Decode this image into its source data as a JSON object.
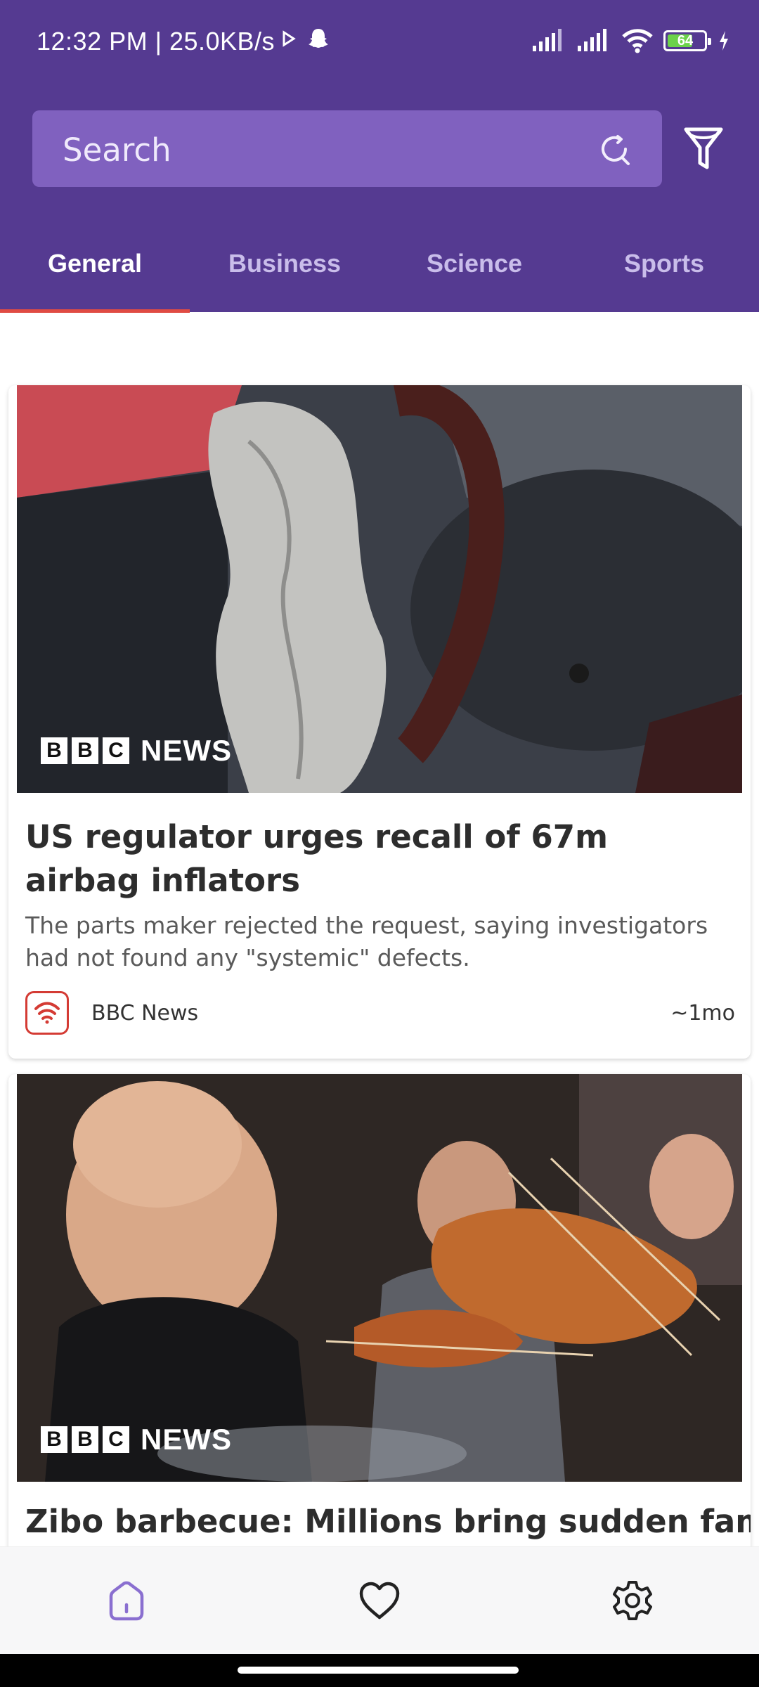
{
  "status_bar": {
    "time_speed": "12:32 PM | 25.0KB/s",
    "battery_level": "64"
  },
  "search": {
    "placeholder": "Search"
  },
  "tabs": [
    {
      "label": "General",
      "active": true
    },
    {
      "label": "Business",
      "active": false
    },
    {
      "label": "Science",
      "active": false
    },
    {
      "label": "Sports",
      "active": false
    }
  ],
  "articles": [
    {
      "image_logo": {
        "letters": [
          "B",
          "B",
          "C"
        ],
        "word": "NEWS"
      },
      "title": "US regulator urges recall of 67m airbag inflators",
      "description": "The parts maker rejected the request, saying investigators had not found any \"systemic\" defects.",
      "source": "BBC News",
      "time": "~1mo"
    },
    {
      "image_logo": {
        "letters": [
          "B",
          "B",
          "C"
        ],
        "word": "NEWS"
      },
      "title": "Zibo barbecue: Millions bring sudden fame"
    }
  ],
  "bottom_nav": [
    {
      "icon": "home-icon",
      "active": true
    },
    {
      "icon": "heart-icon",
      "active": false
    },
    {
      "icon": "settings-icon",
      "active": false
    }
  ],
  "colors": {
    "header": "#553a91",
    "search_bg": "#8061bf",
    "tab_indicator": "#e04b43",
    "source_icon": "#d43b34",
    "nav_active": "#8a6fd0"
  }
}
